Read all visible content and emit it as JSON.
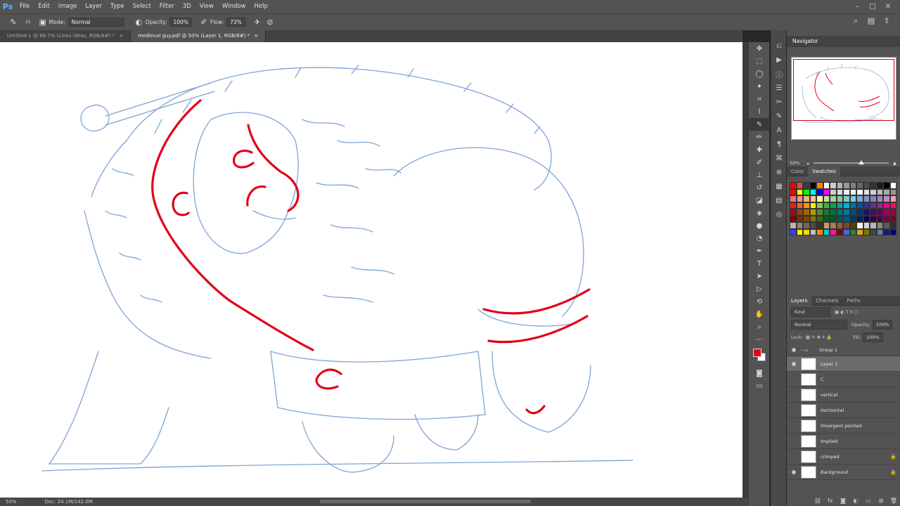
{
  "app": {
    "logo": "Ps"
  },
  "menu": [
    "File",
    "Edit",
    "Image",
    "Layer",
    "Type",
    "Select",
    "Filter",
    "3D",
    "View",
    "Window",
    "Help"
  ],
  "window_controls": [
    "–",
    "□",
    "✕"
  ],
  "options": {
    "brush_size": "15",
    "mode_label": "Mode:",
    "mode_value": "Normal",
    "opacity_label": "Opacity:",
    "opacity_value": "100%",
    "flow_label": "Flow:",
    "flow_value": "73%"
  },
  "tabs": [
    {
      "label": "Untitled-1 @ 66.7% (Lines ideas, RGB/8#) *",
      "close": "×"
    },
    {
      "label": "medieval guy.pdf @ 50% (Layer 1, RGB/8#) *",
      "close": "×"
    }
  ],
  "status": {
    "zoom": "50%",
    "doc": "Doc: 24.1M/142.0M"
  },
  "navigator": {
    "title": "Navigator",
    "zoom": "50%"
  },
  "color_panel": {
    "tabs": [
      "Color",
      "Swatches"
    ]
  },
  "swatch_colors": [
    "#ff0000",
    "#e04c4c",
    "#3d3d3d",
    "#000000",
    "#ff7f00",
    "#ffffff",
    "#cccccc",
    "#b3b3b3",
    "#999999",
    "#808080",
    "#666666",
    "#4d4d4d",
    "#333333",
    "#1a1a1a",
    "#000000",
    "#ffffff",
    "#ff0000",
    "#ffff00",
    "#00ff00",
    "#00ffff",
    "#0000ff",
    "#ff00ff",
    "#cccccc",
    "#dddddd",
    "#eeeeee",
    "#f4f4f4",
    "#ffffff",
    "#e0e0e0",
    "#cfcfcf",
    "#bbbbbb",
    "#aaaaaa",
    "#999999",
    "#f26d7d",
    "#f7977a",
    "#fbad82",
    "#fdc68c",
    "#fff799",
    "#c4df9b",
    "#a2d39c",
    "#82ca9c",
    "#7bcdc8",
    "#6ecff6",
    "#7ea7d8",
    "#8493ca",
    "#8882be",
    "#a187be",
    "#bc8dbf",
    "#f49ac1",
    "#ed1c24",
    "#f26522",
    "#f7941d",
    "#fff200",
    "#8dc63f",
    "#39b54a",
    "#00a651",
    "#00a99d",
    "#00aeef",
    "#0072bc",
    "#0054a6",
    "#2e3192",
    "#662d91",
    "#92278f",
    "#ec008c",
    "#ed145b",
    "#9e0b0f",
    "#a0410d",
    "#a36209",
    "#aba000",
    "#598527",
    "#197b30",
    "#007236",
    "#00746b",
    "#0076a3",
    "#004b80",
    "#003471",
    "#1b1464",
    "#440e62",
    "#630460",
    "#9e005d",
    "#9e0039",
    "#790000",
    "#7b2e00",
    "#7d4900",
    "#827b00",
    "#406618",
    "#005e20",
    "#005826",
    "#005952",
    "#005b7f",
    "#003663",
    "#002157",
    "#0d004c",
    "#32004b",
    "#4b0049",
    "#7b0046",
    "#7a0026",
    "#c7b299",
    "#998675",
    "#736357",
    "#534741",
    "#37302d",
    "#c69c6d",
    "#a67c52",
    "#8c6239",
    "#754c24",
    "#603913",
    "#ffffff",
    "#d4d4d4",
    "#b8b8b8",
    "#8a8a8a",
    "#5c5c5c",
    "#2e2e2e",
    "#3c3cff",
    "#ffff00",
    "#ffd700",
    "#c0c0c0",
    "#ff8c00",
    "#00ced1",
    "#ff1493",
    "#8b0000",
    "#4169e1",
    "#228b22",
    "#daa520",
    "#808000",
    "#2f4f4f",
    "#708090",
    "#191970",
    "#000080"
  ],
  "layers_panel": {
    "tabs": [
      "Layers",
      "Channels",
      "Paths"
    ],
    "kind_label": "Kind",
    "blend_mode": "Normal",
    "opacity_label": "Opacity:",
    "opacity_value": "100%",
    "lock_label": "Lock:",
    "fill_label": "Fill:",
    "fill_value": "100%",
    "layers": [
      {
        "name": "Group 1",
        "visible": true
      },
      {
        "name": "Layer 1",
        "visible": true
      },
      {
        "name": "C",
        "visible": false
      },
      {
        "name": "vertical",
        "visible": false
      },
      {
        "name": "Horizontal",
        "visible": false
      },
      {
        "name": "Divergent pointed",
        "visible": false
      },
      {
        "name": "Implied",
        "visible": false
      },
      {
        "name": "crimped",
        "visible": false
      },
      {
        "name": "Background",
        "visible": true
      }
    ]
  }
}
